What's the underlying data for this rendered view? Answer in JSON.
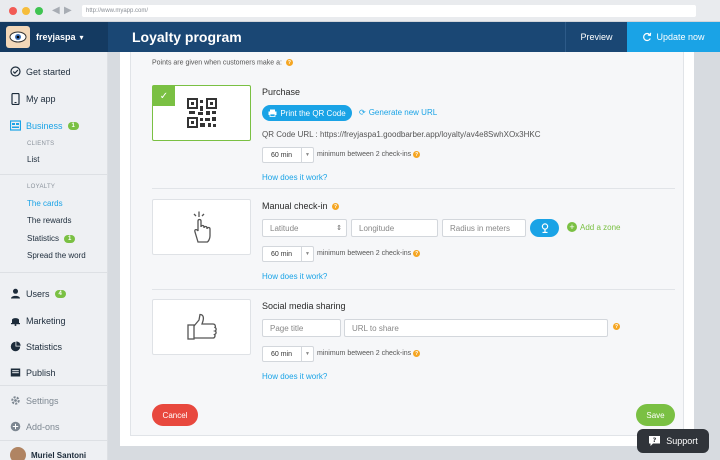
{
  "browser": {
    "url": "http://www.myapp.com/"
  },
  "topbar": {
    "username": "freyjaspa",
    "title": "Loyalty program",
    "preview_label": "Preview",
    "update_label": "Update now"
  },
  "sidebar": {
    "items": [
      {
        "label": "Get started",
        "icon": "check-circle-icon"
      },
      {
        "label": "My app",
        "icon": "phone-icon"
      },
      {
        "label": "Business",
        "icon": "business-icon",
        "badge": "1"
      },
      {
        "label": "Users",
        "icon": "user-icon",
        "badge": "4"
      },
      {
        "label": "Marketing",
        "icon": "bell-icon"
      },
      {
        "label": "Statistics",
        "icon": "pie-chart-icon"
      },
      {
        "label": "Publish",
        "icon": "publish-icon"
      },
      {
        "label": "Settings",
        "icon": "gear-icon"
      },
      {
        "label": "Add-ons",
        "icon": "plus-circle-icon"
      }
    ],
    "clients_group": "CLIENTS",
    "clients_items": [
      {
        "label": "List"
      }
    ],
    "loyalty_group": "LOYALTY",
    "loyalty_items": [
      {
        "label": "The cards"
      },
      {
        "label": "The rewards"
      },
      {
        "label": "Statistics",
        "badge": "1"
      },
      {
        "label": "Spread the word"
      }
    ],
    "footer_user": "Muriel Santoni"
  },
  "main": {
    "intro": "Points are given when customers make a:",
    "purchase": {
      "title": "Purchase",
      "print_label": "Print the QR Code",
      "generate_label": "Generate new URL",
      "qr_url": "QR Code URL : https://freyjaspa1.goodbarber.app/loyalty/av4e8SwhXOx3HKC",
      "interval": "60 min",
      "interval_label": "minimum between 2 check-ins",
      "how_label": "How does it work?"
    },
    "manual": {
      "title": "Manual check-in",
      "latitude_placeholder": "Latitude",
      "longitude_placeholder": "Longitude",
      "radius_placeholder": "Radius in meters",
      "add_zone_label": "Add a zone",
      "interval": "60 min",
      "interval_label": "minimum between 2 check-ins",
      "how_label": "How does it work?"
    },
    "social": {
      "title": "Social media sharing",
      "page_title_placeholder": "Page title",
      "url_placeholder": "URL to share",
      "interval": "60 min",
      "interval_label": "minimum between 2 check-ins",
      "how_label": "How does it work?"
    },
    "cancel_label": "Cancel",
    "save_label": "Save"
  },
  "support_label": "Support",
  "colors": {
    "accent": "#1aa3e6",
    "green": "#7ac043",
    "navy": "#1a4774",
    "red": "#e8483e"
  }
}
